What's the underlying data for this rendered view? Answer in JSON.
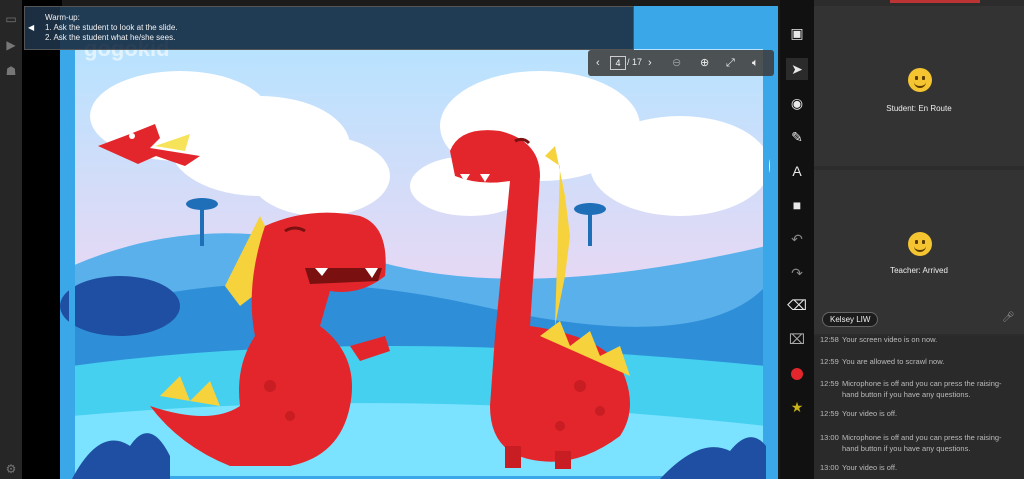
{
  "warmup": {
    "title": "Warm-up:",
    "line1": "1. Ask the student to look at the slide.",
    "line2": "2. Ask the student what he/she sees."
  },
  "slide": {
    "current_page": "4",
    "total_pages": "/ 17",
    "logo": "gogokid"
  },
  "tiles": {
    "student_status": "Student: En Route",
    "teacher_status": "Teacher: Arrived",
    "teacher_name": "Kelsey LIW"
  },
  "log": [
    {
      "time": "12:58",
      "msg": "Your screen video is on now."
    },
    {
      "time": "12:59",
      "msg": "You are allowed to scrawl now."
    },
    {
      "time": "12:59",
      "msg": "Microphone is off and you can press the raising-hand button if you have any questions."
    },
    {
      "time": "12:59",
      "msg": "Your video is off."
    },
    {
      "time": "13:00",
      "msg": "Microphone is off and you can press the raising-hand button if you have any questions."
    },
    {
      "time": "13:00",
      "msg": "Your video is off."
    }
  ],
  "colors": {
    "pen_color": "#e3262b",
    "accent_red": "#b33333",
    "smiley": "#f5c431"
  }
}
